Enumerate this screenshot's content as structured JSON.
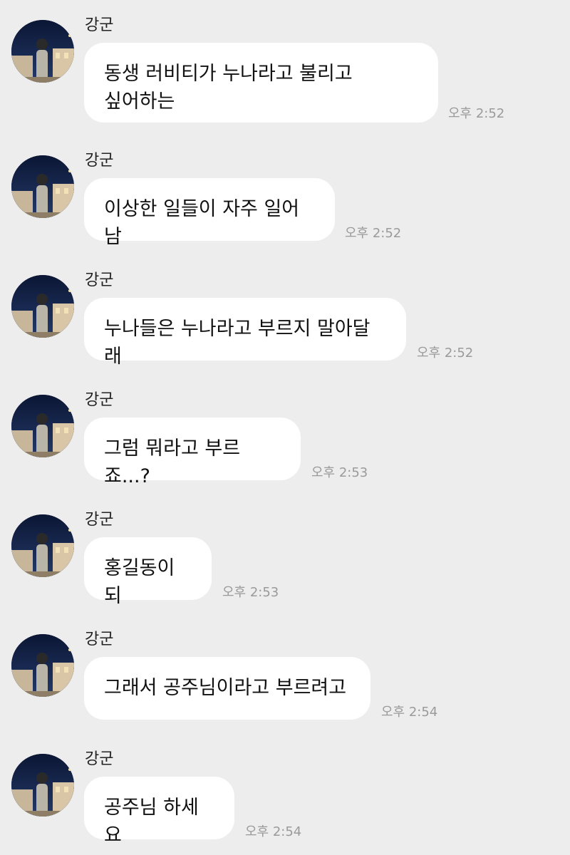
{
  "messages": [
    {
      "sender": "강군",
      "text": "동생 러비티가 누나라고 불리고\n싶어하는",
      "time": "오후 2:52"
    },
    {
      "sender": "강군",
      "text": "이상한 일들이 자주 일어남",
      "time": "오후 2:52"
    },
    {
      "sender": "강군",
      "text": "누나들은 누나라고 부르지 말아달래",
      "time": "오후 2:52"
    },
    {
      "sender": "강군",
      "text": "그럼 뭐라고 부르죠...?",
      "time": "오후 2:53"
    },
    {
      "sender": "강군",
      "text": "홍길동이되",
      "time": "오후 2:53"
    },
    {
      "sender": "강군",
      "text": "그래서 공주님이라고 부르려고",
      "time": "오후 2:54"
    },
    {
      "sender": "강군",
      "text": "공주님 하세요",
      "time": "오후 2:54"
    }
  ],
  "colors": {
    "background": "#ededed",
    "bubble": "#ffffff",
    "timestamp": "#9a9a9a"
  },
  "icons": {
    "avatar": "profile-photo-night-street"
  }
}
